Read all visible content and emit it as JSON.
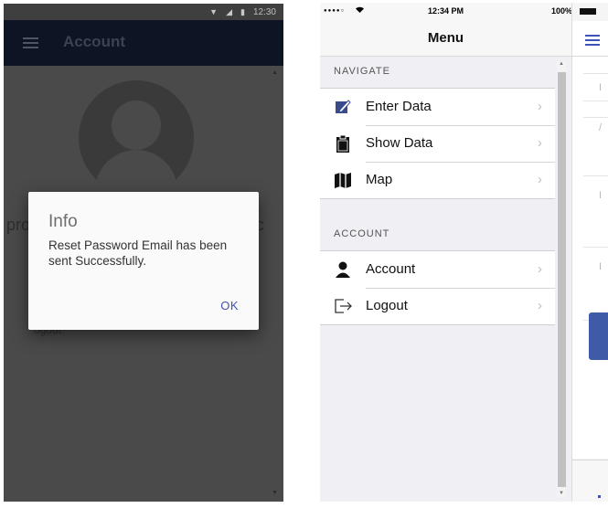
{
  "android": {
    "status": {
      "time": "12:30"
    },
    "toolbar": {
      "title": "Account"
    },
    "background_text": {
      "left": "pro",
      "right": "c",
      "under": "ogout"
    },
    "dialog": {
      "title": "Info",
      "message": "Reset Password Email has been sent Successfully.",
      "ok_label": "OK"
    }
  },
  "ios": {
    "status": {
      "time": "12:34 PM",
      "battery": "100%"
    },
    "navbar": {
      "title": "Menu"
    },
    "sections": [
      {
        "header": "NAVIGATE",
        "items": [
          {
            "label": "Enter Data",
            "icon": "edit-icon"
          },
          {
            "label": "Show Data",
            "icon": "clipboard-icon"
          },
          {
            "label": "Map",
            "icon": "map-icon"
          }
        ]
      },
      {
        "header": "ACCOUNT",
        "items": [
          {
            "label": "Account",
            "icon": "user-icon"
          },
          {
            "label": "Logout",
            "icon": "logout-icon"
          }
        ]
      }
    ]
  },
  "colors": {
    "android_toolbar": "#0d1423",
    "dialog_accent": "#3f51b5",
    "ios_background": "#efeff4",
    "partial_button": "#3f5aa6"
  }
}
